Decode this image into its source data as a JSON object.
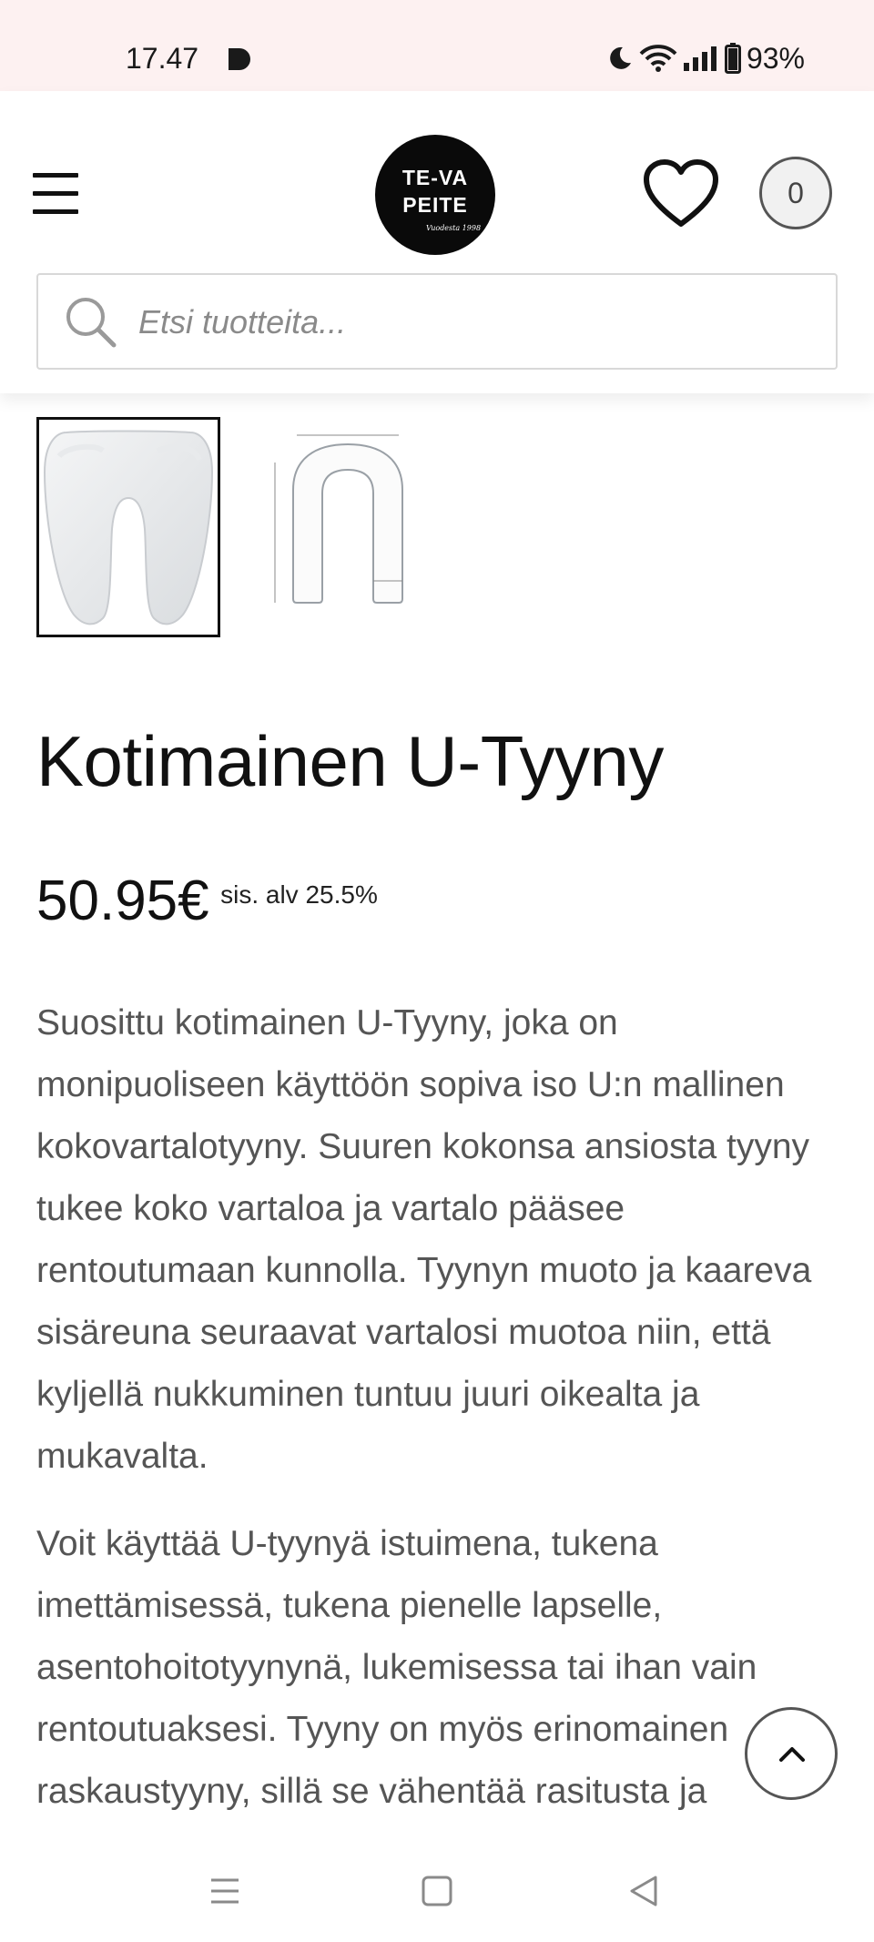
{
  "status_bar": {
    "time": "17.47",
    "battery": "93%",
    "icons": [
      "media-play-icon",
      "moon-icon",
      "wifi-icon",
      "signal-icon",
      "battery-icon"
    ]
  },
  "header": {
    "logo": {
      "line1": "TE-VA",
      "line2": "PEITE",
      "script": "Vuodesta 1998"
    },
    "cart_count": "0",
    "search": {
      "placeholder": "Etsi tuotteita..."
    }
  },
  "gallery": {
    "thumbnails": [
      {
        "name": "u-pillow-photo",
        "selected": true
      },
      {
        "name": "u-pillow-dimension-drawing",
        "selected": false
      }
    ]
  },
  "product": {
    "title": "Kotimainen U-Tyyny",
    "price": "50.95€",
    "tax_note": "sis. alv 25.5%",
    "description": [
      "Suosittu kotimainen U-Tyyny, joka on monipuoliseen käyttöön sopiva iso U:n mallinen kokovartalotyyny. Suuren kokonsa ansiosta tyyny tukee koko vartaloa ja vartalo pääsee rentoutumaan kunnolla. Tyynyn muoto ja kaareva sisäreuna seuraavat vartalosi muotoa niin, että kyljellä nukkuminen tuntuu juuri oikealta ja mukavalta.",
      "Voit käyttää U-tyynyä istuimena, tukena imettämisessä, tukena pienelle lapselle, asentohoitotyynynä, lukemisessa tai ihan vain rentoutuaksesi. Tyyny on myös erinomainen raskaustyyny, sillä se vähentää rasitusta ja"
    ]
  },
  "colors": {
    "status_bar_bg": "#fdf1f1",
    "text": "#111111",
    "body_text": "#555555",
    "logo_bg": "#0a0a0a"
  }
}
